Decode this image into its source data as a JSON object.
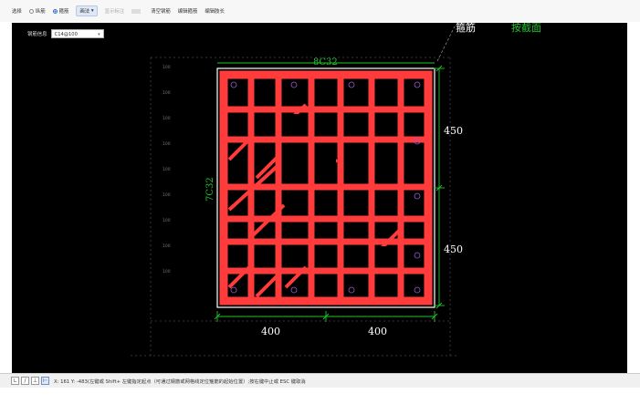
{
  "toolbar": {
    "select_label": "选择",
    "radio1_label": "纵筋",
    "radio2_label": "箍筋",
    "draw_label": "画法",
    "show_label": "显示标注",
    "clear_label": "清空钢筋",
    "edit_ref_label": "编辑箍筋",
    "edit_leg_label": "编辑肢长"
  },
  "canvas": {
    "stirrup_label": "钢筋信息",
    "stirrup_value": "C14@100",
    "top_rebar": "8C32",
    "side_rebar": "7C32",
    "dim_right_top": "450",
    "dim_right_bottom": "450",
    "dim_bottom_left": "400",
    "dim_bottom_right": "400",
    "callout_1": "箍筋",
    "callout_2": "按截面",
    "grid_ticks": [
      "100",
      "100",
      "100",
      "100",
      "100",
      "100",
      "100",
      "100",
      "100"
    ]
  },
  "statusbar": {
    "text": "X: 161 Y: -483(左键或 Shift+ 左键指定起点（可通过钢筋或网格线定位箍筋的起始位置）;按右键中止或 ESC 键取消"
  },
  "colors": {
    "canvas_bg": "#000000",
    "rebar": "#ff3b3b",
    "dim": "#22c32e",
    "outline": "#ffffff"
  }
}
